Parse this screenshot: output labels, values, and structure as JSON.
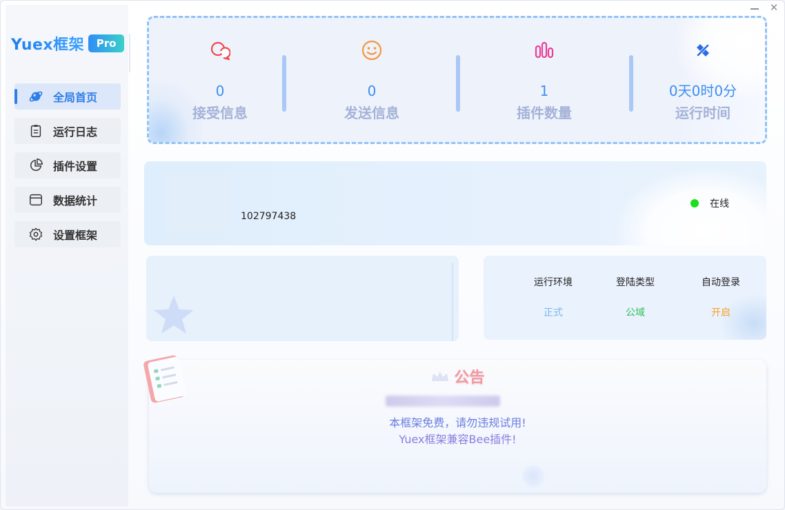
{
  "window": {
    "minimize_glyph": "—",
    "close_glyph": "✕"
  },
  "brand": {
    "name": "Yuex框架",
    "badge": "Pro"
  },
  "sidebar": {
    "items": [
      {
        "label": "全局首页",
        "icon": "planet-icon",
        "active": true
      },
      {
        "label": "运行日志",
        "icon": "clipboard-icon",
        "active": false
      },
      {
        "label": "插件设置",
        "icon": "pie-icon",
        "active": false
      },
      {
        "label": "数据统计",
        "icon": "window-icon",
        "active": false
      },
      {
        "label": "设置框架",
        "icon": "gear-icon",
        "active": false
      }
    ]
  },
  "stats": [
    {
      "value": "0",
      "label": "接受信息",
      "icon": "chat-bubbles-icon",
      "color": "#f0474e"
    },
    {
      "value": "0",
      "label": "发送信息",
      "icon": "smiley-icon",
      "color": "#f5963a"
    },
    {
      "value": "1",
      "label": "插件数量",
      "icon": "bars-icon",
      "color": "#e93f95"
    },
    {
      "value": "0天0时0分",
      "label": "运行时间",
      "icon": "satellite-icon",
      "color": "#2a6de6"
    }
  ],
  "profile": {
    "account_id": "102797438",
    "status_label": "在线",
    "status_color": "#19e019"
  },
  "info": {
    "columns": [
      {
        "label": "运行环境",
        "value": "正式",
        "color": "#7bb5f0"
      },
      {
        "label": "登陆类型",
        "value": "公域",
        "color": "#2fbf5e"
      },
      {
        "label": "自动登录",
        "value": "开启",
        "color": "#f5a030"
      }
    ]
  },
  "notice": {
    "title": "公告",
    "line1": "本框架免费，请勿违规试用!",
    "line2": "Yuex框架兼容Bee插件!"
  },
  "colors": {
    "accent": "#2f7de8",
    "stat_value": "#3d8ef0",
    "stat_label": "#a5b2d8"
  }
}
